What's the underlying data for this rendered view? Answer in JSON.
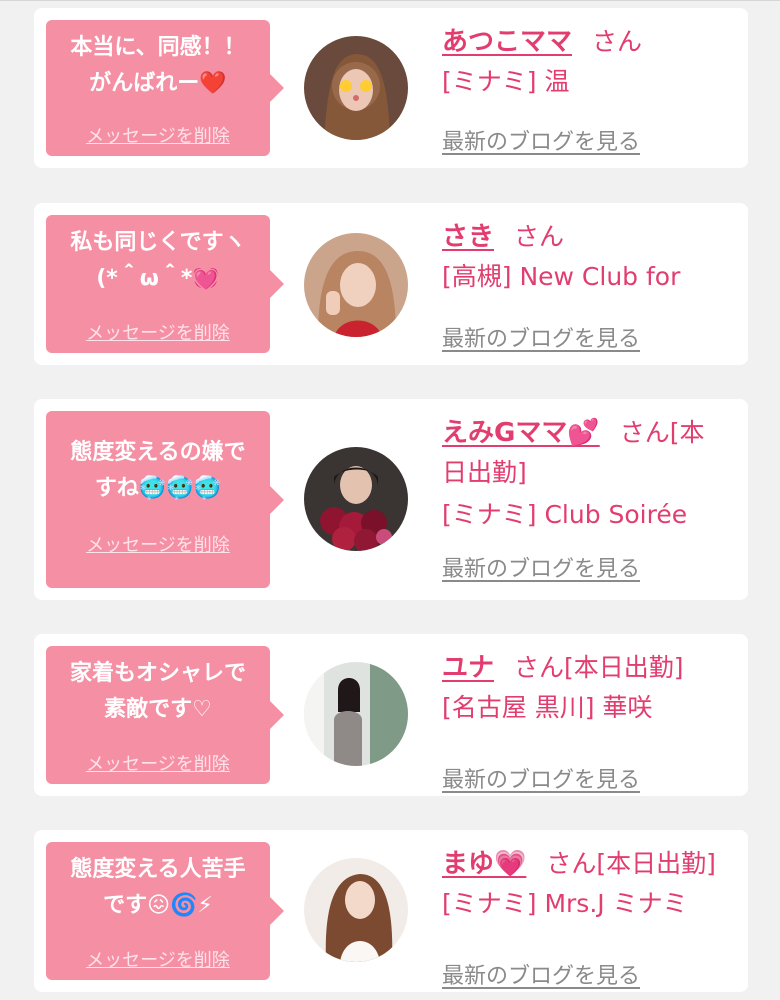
{
  "delete_label": "メッセージを削除",
  "blog_label": "最新のブログを見る",
  "san_label": "さん",
  "colors": {
    "bubble": "#f58fa4",
    "name": "#e23d6f",
    "link": "#8a8a8a",
    "background": "#f1f1f1"
  },
  "cards": [
    {
      "message": "本当に、同感！！\nがんばれー❤️",
      "name": "あつこママ",
      "suffix": "さん",
      "shop": "[ミナミ] 温"
    },
    {
      "message": "私も同じくですヽ\n(*＾ω＾*💓",
      "name": "さき",
      "suffix": "さん",
      "shop": "[高槻] New Club for"
    },
    {
      "message": "態度変えるの嫌で\nすね🥶🥶🥶",
      "name": "えみGママ💕",
      "suffix": "さん[本\n日出勤]",
      "shop": "[ミナミ] Club Soirée"
    },
    {
      "message": "家着もオシャレで\n素敵です♡",
      "name": "ユナ",
      "suffix": "さん[本日出勤]",
      "shop": "[名古屋 黒川] 華咲"
    },
    {
      "message": "態度変える人苦手\nです😖🌀⚡",
      "name": "まゆ💗",
      "suffix": "さん[本日出勤]",
      "shop": "[ミナミ] Mrs.J ミナミ"
    }
  ]
}
